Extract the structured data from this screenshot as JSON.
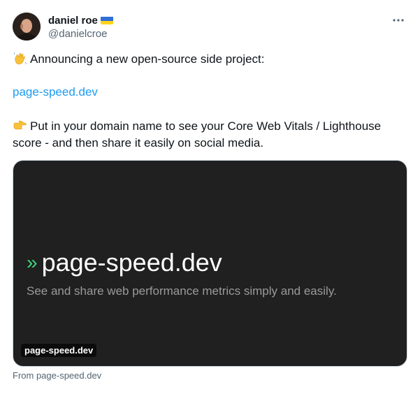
{
  "author": {
    "display_name": "daniel roe",
    "handle": "@danielcroe",
    "flag": "ukraine-flag-icon"
  },
  "menu": {
    "icon": "more-horizontal-icon"
  },
  "tweet": {
    "line1": "Announcing a new open-source side project:",
    "line1_emoji": "waving-hand-icon",
    "link": "page-speed.dev",
    "line3": "Put in your domain name to see your Core Web Vitals / Lighthouse score - and then share it easily on social media.",
    "line3_emoji": "pointing-right-icon"
  },
  "card": {
    "chevron": "»",
    "title": "page-speed.dev",
    "subtitle": "See and share web performance metrics simply and easily.",
    "domain_badge": "page-speed.dev",
    "from_label": "From page-speed.dev"
  },
  "colors": {
    "link": "#1d9bf0",
    "card_background": "#202020",
    "chevron": "#3fd67b"
  }
}
